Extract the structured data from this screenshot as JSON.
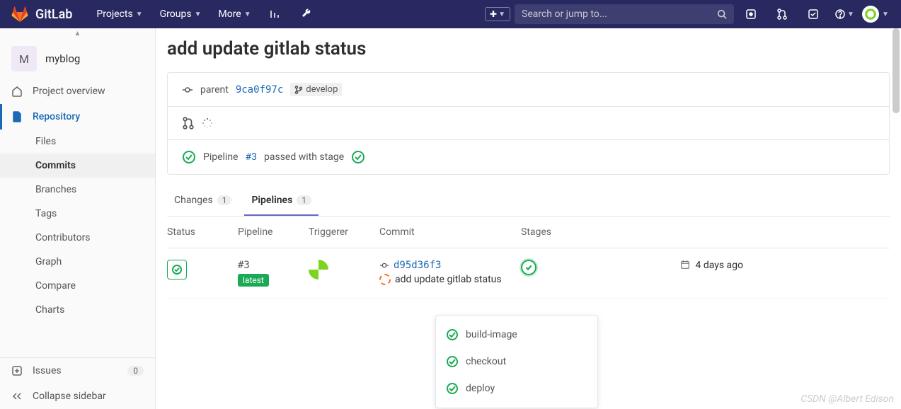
{
  "brand": "GitLab",
  "topnav": {
    "projects": "Projects",
    "groups": "Groups",
    "more": "More"
  },
  "search": {
    "placeholder": "Search or jump to..."
  },
  "project": {
    "initial": "M",
    "name": "myblog"
  },
  "sidebar": {
    "overview": "Project overview",
    "repository": "Repository",
    "files": "Files",
    "commits": "Commits",
    "branches": "Branches",
    "tags": "Tags",
    "contributors": "Contributors",
    "graph": "Graph",
    "compare": "Compare",
    "charts": "Charts",
    "issues": "Issues",
    "issues_count": "0",
    "collapse": "Collapse sidebar"
  },
  "page": {
    "title": "add update gitlab status",
    "parent_label": "parent",
    "parent_sha": "9ca0f97c",
    "branch": "develop",
    "pipeline_text_prefix": "Pipeline ",
    "pipeline_link": "#3",
    "pipeline_text_suffix": " passed with stage"
  },
  "tabs": {
    "changes": "Changes",
    "changes_count": "1",
    "pipelines": "Pipelines",
    "pipelines_count": "1"
  },
  "table": {
    "headers": {
      "status": "Status",
      "pipeline": "Pipeline",
      "triggerer": "Triggerer",
      "commit": "Commit",
      "stages": "Stages"
    },
    "row": {
      "pipeline_id": "#3",
      "tag": "latest",
      "commit_sha": "d95d36f3",
      "commit_msg": "add update gitlab status",
      "time": "4 days ago"
    }
  },
  "dropdown": {
    "items": [
      "build-image",
      "checkout",
      "deploy"
    ]
  },
  "watermark": "CSDN @Albert Edison"
}
